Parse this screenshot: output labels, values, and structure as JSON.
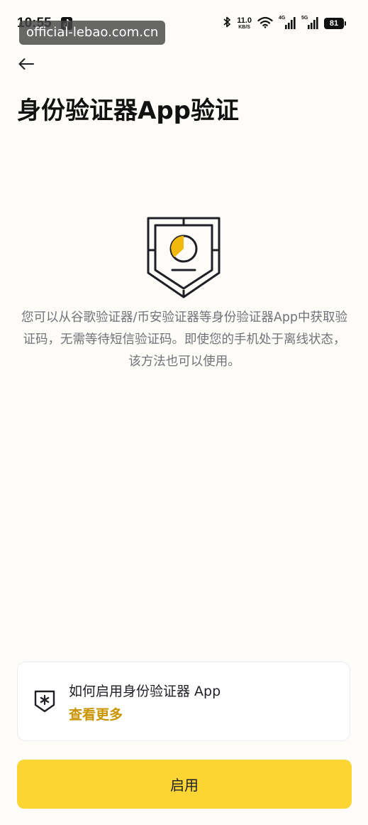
{
  "status_bar": {
    "time": "10:55",
    "watermark": "official-lebao.com.cn",
    "net_speed_value": "11.0",
    "net_speed_unit": "KB/S",
    "signal_1_label": "4G",
    "signal_2_label": "5G",
    "battery": "81",
    "icons": [
      "tiktok-icon",
      "bluetooth-icon",
      "wifi-icon",
      "signal-icon",
      "signal-icon",
      "battery-icon"
    ]
  },
  "header": {
    "back_icon": "arrow-left-icon",
    "title": "身份验证器App验证"
  },
  "main": {
    "illustration_icon": "authenticator-shield-icon",
    "description": "您可以从谷歌验证器/币安验证器等身份验证器App中获取验证码，无需等待短信验证码。即使您的手机处于离线状态，该方法也可以使用。"
  },
  "info_card": {
    "icon": "shield-asterisk-icon",
    "title": "如何启用身份验证器 App",
    "link": "查看更多"
  },
  "footer": {
    "enable_label": "启用"
  },
  "colors": {
    "accent": "#FCD535",
    "link": "#C99400",
    "background": "#FDFCF8",
    "text_primary": "#1E2026",
    "text_secondary": "#6F7277"
  }
}
